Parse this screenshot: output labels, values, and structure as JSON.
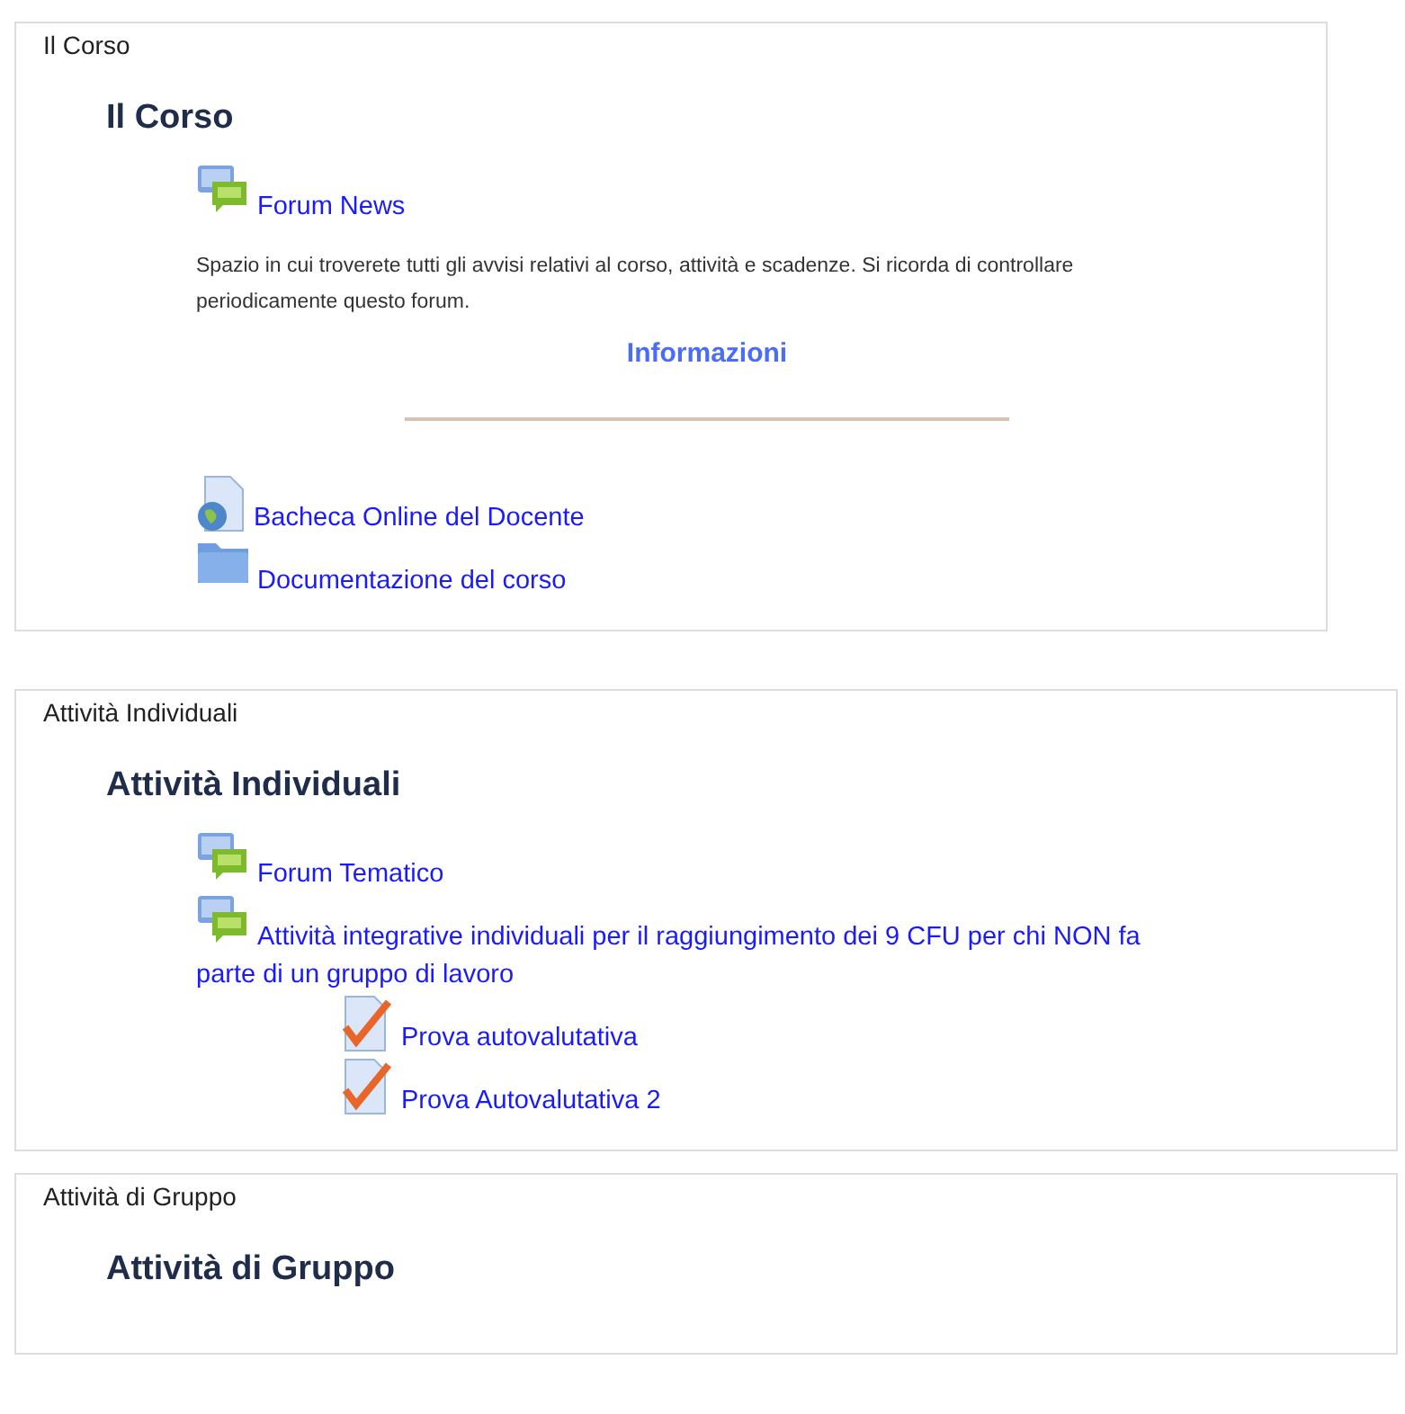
{
  "sections": [
    {
      "title": "Il Corso",
      "heading": "Il Corso",
      "items": [
        {
          "kind": "forum",
          "label": "Forum News"
        },
        {
          "kind": "text",
          "text": "Spazio in cui troverete tutti gli avvisi relativi al corso, attività e scadenze. Si ricorda di controllare periodicamente questo forum."
        },
        {
          "kind": "heading",
          "text": "Informazioni"
        },
        {
          "kind": "divider"
        },
        {
          "kind": "page",
          "label": "Bacheca Online del Docente"
        },
        {
          "kind": "folder",
          "label": "Documentazione del corso"
        }
      ]
    },
    {
      "title": "Attività Individuali",
      "heading": "Attività Individuali",
      "items": [
        {
          "kind": "forum",
          "label": "Forum Tematico"
        },
        {
          "kind": "forum",
          "label": "Attività integrative individuali per il raggiungimento dei 9 CFU per chi NON fa parte di un gruppo di lavoro",
          "children": [
            {
              "kind": "quiz",
              "label": "Prova autovalutativa"
            },
            {
              "kind": "quiz",
              "label": "Prova Autovalutativa 2"
            }
          ]
        }
      ]
    },
    {
      "title": "Attività di Gruppo",
      "heading": "Attività di Gruppo"
    }
  ]
}
